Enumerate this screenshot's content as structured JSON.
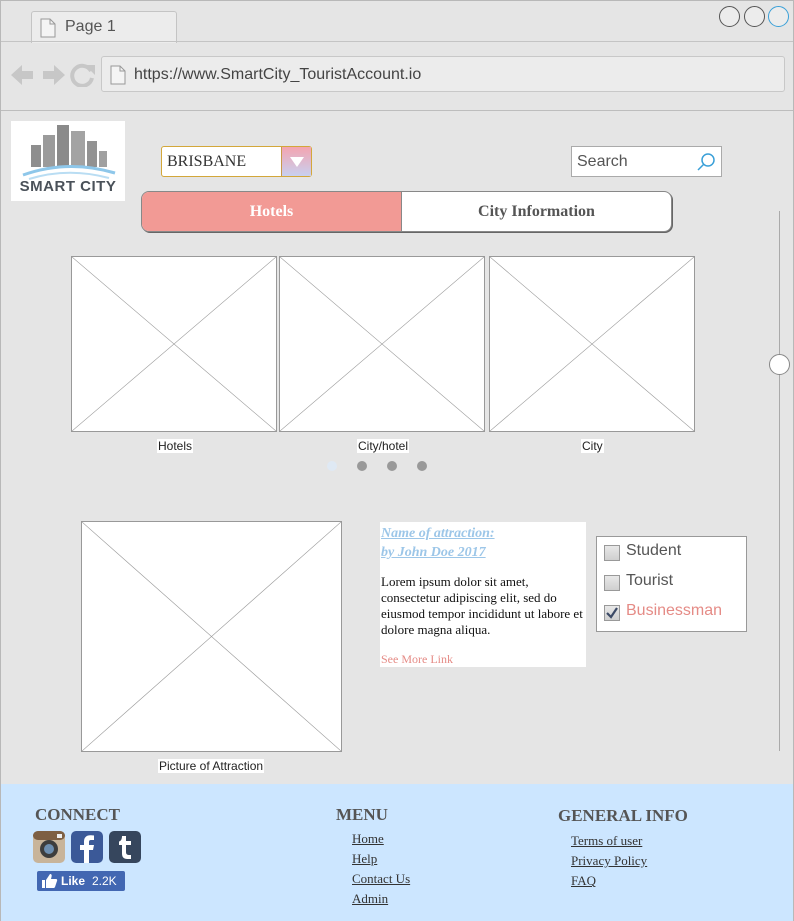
{
  "browser": {
    "tab_title": "Page 1",
    "url": "https://www.SmartCity_TouristAccount.io"
  },
  "header": {
    "logo_text": "SMART CITY",
    "city_select": {
      "value": "BRISBANE"
    },
    "search": {
      "placeholder": "Search"
    }
  },
  "tabs": [
    {
      "label": "Hotels",
      "active": true
    },
    {
      "label": "City Information",
      "active": false
    }
  ],
  "carousel": {
    "items": [
      {
        "caption": "Hotels"
      },
      {
        "caption": "City/hotel"
      },
      {
        "caption": "City"
      }
    ],
    "dot_count": 4,
    "active_dot": 0
  },
  "attraction": {
    "image_caption": "Picture of Attraction",
    "title_line1": "Name of attraction:",
    "title_line2": "by John Doe 2017",
    "body": "Lorem ipsum dolor sit amet, consectetur adipiscing elit, sed do eiusmod tempor incididunt ut labore et dolore magna aliqua.",
    "more_link": "See More Link"
  },
  "user_types": [
    {
      "label": "Student",
      "checked": false
    },
    {
      "label": "Tourist",
      "checked": false
    },
    {
      "label": "Businessman",
      "checked": true
    }
  ],
  "footer": {
    "connect": {
      "heading": "CONNECT",
      "icons": [
        "instagram-icon",
        "facebook-icon",
        "tumblr-icon"
      ],
      "like_label": "Like",
      "like_count": "2.2K"
    },
    "menu": {
      "heading": "MENU",
      "links": [
        "Home",
        "Help",
        "Contact Us",
        "Admin"
      ]
    },
    "general": {
      "heading": "GENERAL INFO",
      "links": [
        "Terms of user",
        "Privacy Policy",
        "FAQ"
      ]
    }
  },
  "colors": {
    "active_tab": "#f29a95",
    "accent_pink": "#e58b86",
    "link_blue": "#9cc6e8",
    "footer_bg": "#cce6ff",
    "facebook_blue": "#4267b2"
  }
}
